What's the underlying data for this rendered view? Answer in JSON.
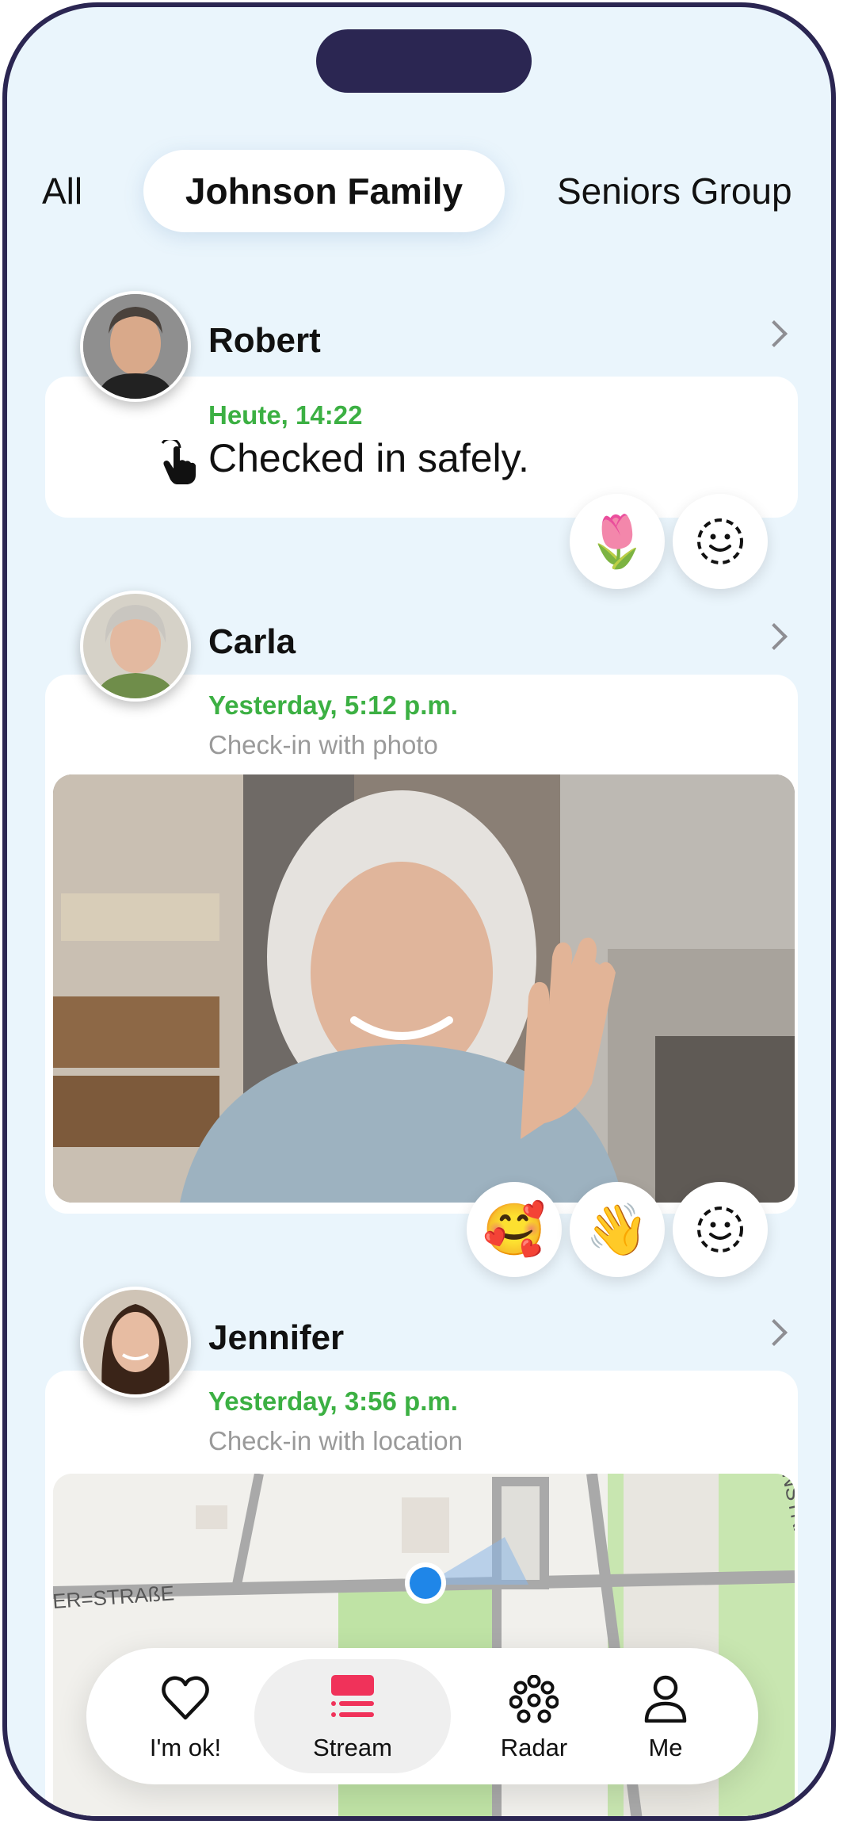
{
  "tabs": [
    {
      "label": "All"
    },
    {
      "label": "Johnson Family"
    },
    {
      "label": "Seniors Group"
    }
  ],
  "feed": [
    {
      "name": "Robert",
      "time": "Heute, 14:22",
      "message": "Checked in safely.",
      "reactions": [
        "🌷"
      ]
    },
    {
      "name": "Carla",
      "time": "Yesterday, 5:12 p.m.",
      "subtitle": "Check-in with photo",
      "reactions": [
        "🥰",
        "👋"
      ]
    },
    {
      "name": "Jennifer",
      "time": "Yesterday, 3:56 p.m.",
      "subtitle": "Check-in with location"
    }
  ],
  "map": {
    "street_left": "ER=STRAßE",
    "street_right": "NSTRAßE"
  },
  "nav": [
    {
      "label": "I'm ok!",
      "icon": "heart-icon"
    },
    {
      "label": "Stream",
      "icon": "stream-icon",
      "active": true
    },
    {
      "label": "Radar",
      "icon": "radar-icon"
    },
    {
      "label": "Me",
      "icon": "person-icon"
    }
  ],
  "colors": {
    "accent_green": "#3cb043",
    "accent_pink": "#f0325a",
    "frame": "#2b2652",
    "background": "#eaf5fc"
  }
}
